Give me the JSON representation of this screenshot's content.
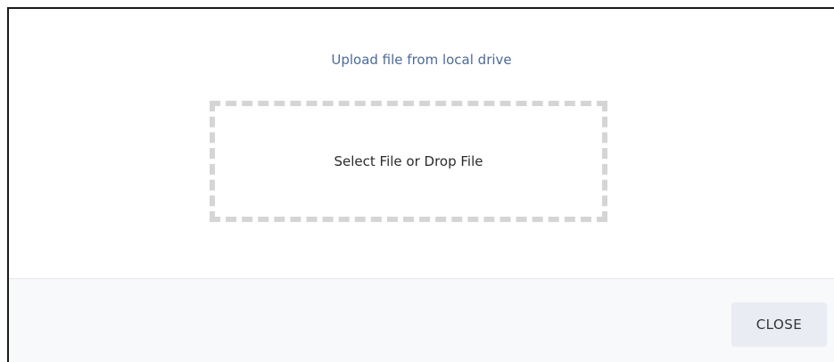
{
  "upload": {
    "title": "Upload file from local drive",
    "drop_label": "Select File or Drop File"
  },
  "footer": {
    "close_label": "CLOSE"
  }
}
